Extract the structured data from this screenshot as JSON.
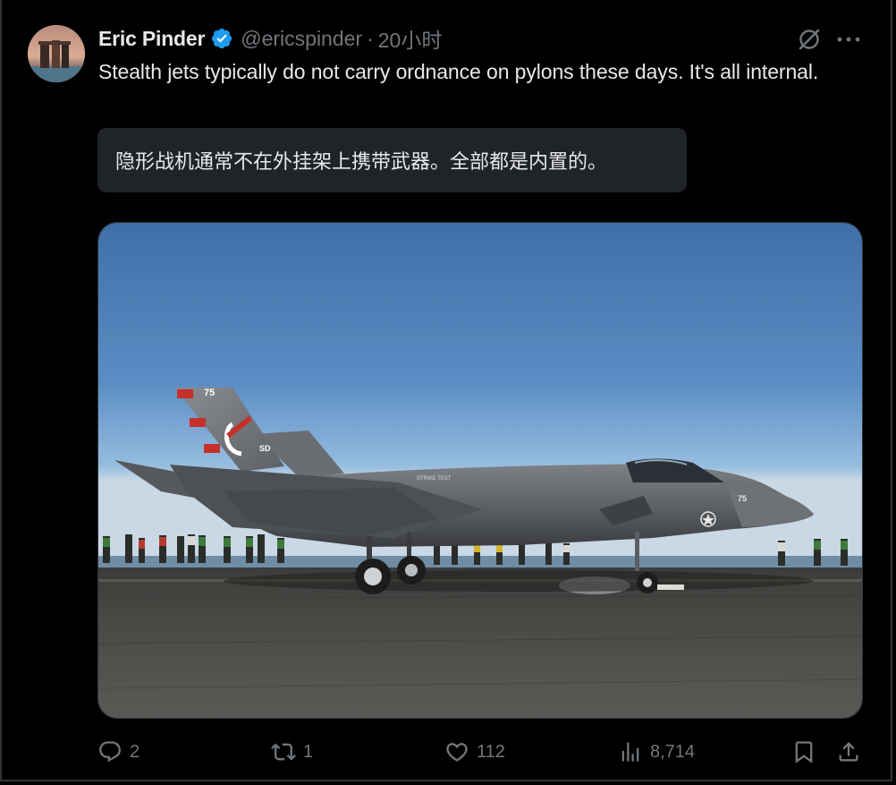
{
  "post": {
    "author": {
      "name": "Eric Pinder",
      "handle": "@ericspinder",
      "separator": "·",
      "time": "20小时",
      "verified": true
    },
    "text": "Stealth jets typically do not carry ordnance on pylons these days. It's all internal.",
    "translation": "隐形战机通常不在外挂架上携带武器。全部都是内置的。",
    "media": {
      "aircraft_markings": {
        "tail_number": "75",
        "nose_number": "75",
        "fuselage_text": "STRIKE TEST",
        "tail_code": "SD"
      }
    },
    "actions": {
      "replies": "2",
      "reposts": "1",
      "likes": "112",
      "views": "8,714"
    }
  },
  "icons": {
    "verified": "verified-badge-icon",
    "grok": "grok-icon",
    "more": "more-icon",
    "reply": "reply-icon",
    "repost": "repost-icon",
    "like": "heart-icon",
    "views": "views-icon",
    "bookmark": "bookmark-icon",
    "share": "share-icon"
  },
  "colors": {
    "background": "#000000",
    "text": "#e7e9ea",
    "muted": "#71767b",
    "verified": "#1d9bf0",
    "translation_bg": "#202327",
    "border": "#2f3336"
  }
}
